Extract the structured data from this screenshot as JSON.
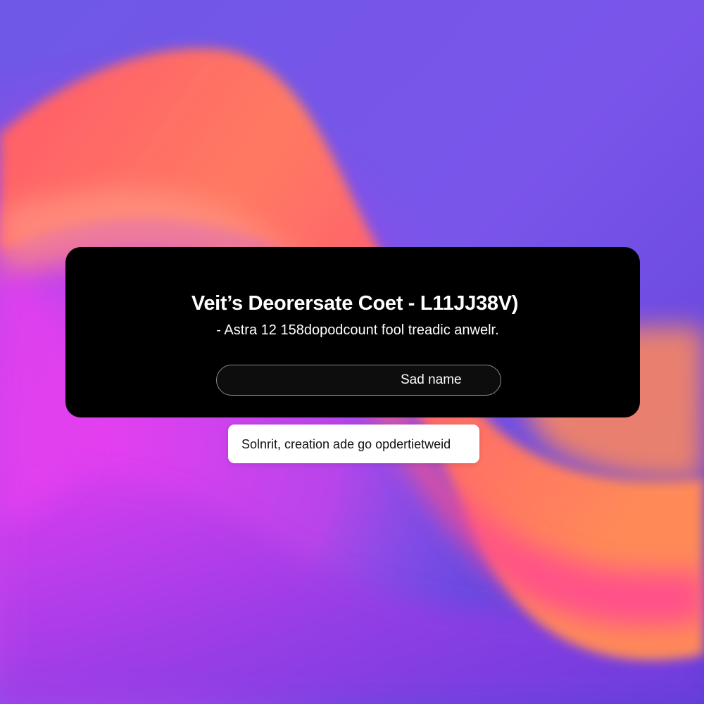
{
  "dialog": {
    "title": "Veit’s Deorersate Coet - L11JJ38V)",
    "subtitle": "- Astra 12 158dopodcount fool treadic anwelr.",
    "name_field": {
      "value": "",
      "label": "Sad name"
    }
  },
  "toast": {
    "text": "Solnrit, creation ade go opdertietweid"
  },
  "colors": {
    "dialog_background": "#000000",
    "toast_background": "#ffffff",
    "wallpaper_purple": "#6a47e0",
    "wallpaper_magenta": "#e83bdc",
    "wallpaper_coral": "#ff6a5a"
  }
}
